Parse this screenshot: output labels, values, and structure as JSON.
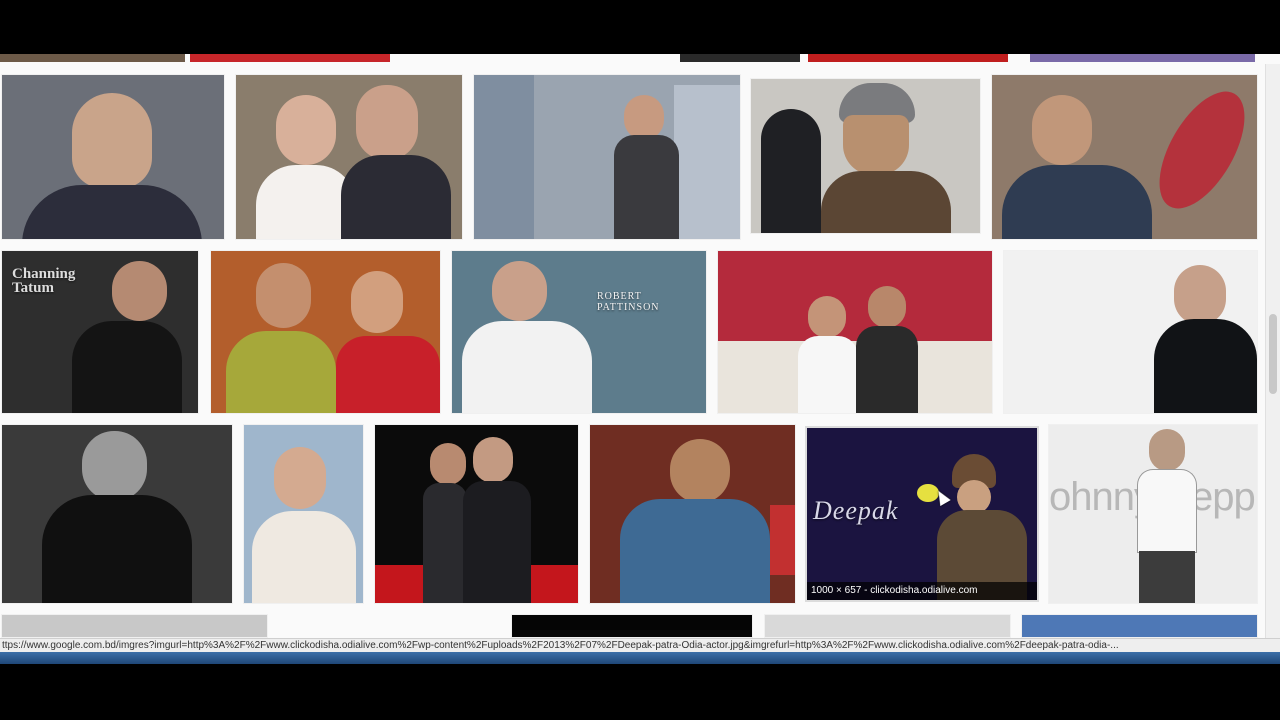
{
  "results": {
    "row1": [
      {
        "name": "thumb-suit-man-un",
        "bg": "#6b6f78",
        "accent": "#2e2f3a"
      },
      {
        "name": "thumb-couple-indoor",
        "bg": "#8a7d6c",
        "accent": "#2b2b34"
      },
      {
        "name": "thumb-woman-trenchcoat",
        "bg": "#9aa4b0",
        "accent": "#3a3a3e"
      },
      {
        "name": "thumb-man-beanie-press",
        "bg": "#c9c7c2",
        "accent": "#5b4634"
      },
      {
        "name": "thumb-shield-hero",
        "bg": "#8e7a6a",
        "accent": "#2f3c52"
      }
    ],
    "row2": [
      {
        "name": "thumb-channing-tatum",
        "bg": "#2e2e2e",
        "accent": "#1a1a1a",
        "caption": "Channing\nTatum"
      },
      {
        "name": "thumb-couple-festive",
        "bg": "#b35e2c",
        "accent": "#a6a83a"
      },
      {
        "name": "thumb-robert-pattinson",
        "bg": "#5d7c8c",
        "accent": "#f2f2f2",
        "caption": "ROBERT PATTINSON"
      },
      {
        "name": "thumb-wedding-couple",
        "bg": "#b42a3c",
        "accent": "#2a2a2a"
      },
      {
        "name": "thumb-man-black-shirt",
        "bg": "#f1f1f1",
        "accent": "#111316"
      }
    ],
    "row3": [
      {
        "name": "thumb-bw-man",
        "bg": "#3a3a3a",
        "accent": "#101010"
      },
      {
        "name": "thumb-woman-white-dress",
        "bg": "#9fb6cc",
        "accent": "#efe9e1"
      },
      {
        "name": "thumb-couple-red-carpet",
        "bg": "#0b0b0b",
        "accent": "#c4161c"
      },
      {
        "name": "thumb-man-guitar",
        "bg": "#6f2d22",
        "accent": "#3e6a94"
      },
      {
        "name": "thumb-deepak",
        "bg": "#1b1440",
        "accent": "#5c4a36",
        "caption": "Deepak",
        "dims": "1000 × 657 - clickodisha.odialive.com"
      },
      {
        "name": "thumb-johnny-depp",
        "bg": "#ededed",
        "accent": "#b7b7b7",
        "caption": "ohnny Depp"
      }
    ]
  },
  "status_url": "ttps://www.google.com.bd/imgres?imgurl=http%3A%2F%2Fwww.clickodisha.odialive.com%2Fwp-content%2Fuploads%2F2013%2F07%2FDeepak-patra-Odia-actor.jpg&imgrefurl=http%3A%2F%2Fwww.clickodisha.odialive.com%2Fdeepak-patra-odia-...",
  "colors": {
    "page_bg": "#fafafa",
    "letterbox": "#000000",
    "taskbar": "#2b5a90"
  }
}
